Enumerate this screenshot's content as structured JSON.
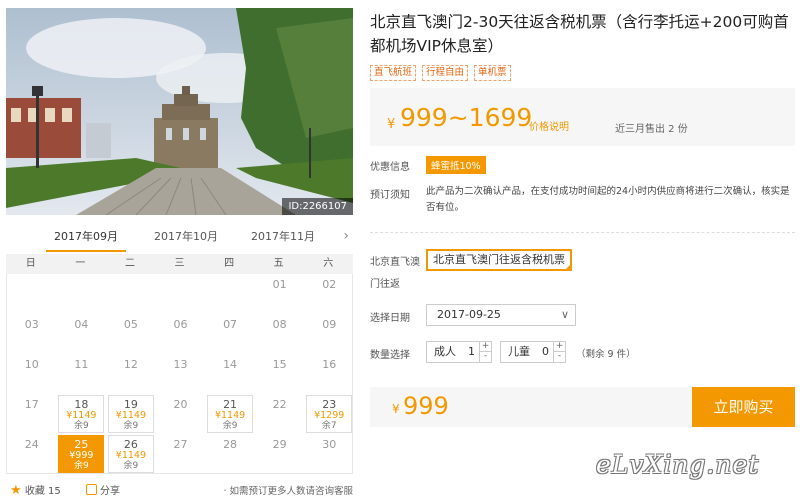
{
  "photo": {
    "id_label": "ID:2266107"
  },
  "calendar": {
    "months": [
      "2017年09月",
      "2017年10月",
      "2017年11月"
    ],
    "weekdays": [
      "日",
      "一",
      "二",
      "三",
      "四",
      "五",
      "六"
    ],
    "cells": [
      {
        "day": "01",
        "col": 5,
        "row": 0
      },
      {
        "day": "02",
        "col": 6,
        "row": 0
      },
      {
        "day": "03",
        "col": 0,
        "row": 1
      },
      {
        "day": "04",
        "col": 1,
        "row": 1
      },
      {
        "day": "05",
        "col": 2,
        "row": 1
      },
      {
        "day": "06",
        "col": 3,
        "row": 1
      },
      {
        "day": "07",
        "col": 4,
        "row": 1
      },
      {
        "day": "08",
        "col": 5,
        "row": 1
      },
      {
        "day": "09",
        "col": 6,
        "row": 1
      },
      {
        "day": "10",
        "col": 0,
        "row": 2
      },
      {
        "day": "11",
        "col": 1,
        "row": 2
      },
      {
        "day": "12",
        "col": 2,
        "row": 2
      },
      {
        "day": "13",
        "col": 3,
        "row": 2
      },
      {
        "day": "14",
        "col": 4,
        "row": 2
      },
      {
        "day": "15",
        "col": 5,
        "row": 2
      },
      {
        "day": "16",
        "col": 6,
        "row": 2
      },
      {
        "day": "17",
        "col": 0,
        "row": 3
      },
      {
        "day": "18",
        "col": 1,
        "row": 3,
        "price": "¥1149",
        "remain": "余9"
      },
      {
        "day": "19",
        "col": 2,
        "row": 3,
        "price": "¥1149",
        "remain": "余9"
      },
      {
        "day": "20",
        "col": 3,
        "row": 3
      },
      {
        "day": "21",
        "col": 4,
        "row": 3,
        "price": "¥1149",
        "remain": "余9"
      },
      {
        "day": "22",
        "col": 5,
        "row": 3
      },
      {
        "day": "23",
        "col": 6,
        "row": 3,
        "price": "¥1299",
        "remain": "余7"
      },
      {
        "day": "24",
        "col": 0,
        "row": 4
      },
      {
        "day": "25",
        "col": 1,
        "row": 4,
        "price": "¥999",
        "remain": "余9",
        "selected": true
      },
      {
        "day": "26",
        "col": 2,
        "row": 4,
        "price": "¥1149",
        "remain": "余9"
      },
      {
        "day": "27",
        "col": 3,
        "row": 4
      },
      {
        "day": "28",
        "col": 4,
        "row": 4
      },
      {
        "day": "29",
        "col": 5,
        "row": 4
      },
      {
        "day": "30",
        "col": 6,
        "row": 4
      }
    ]
  },
  "footer": {
    "favorite_label": "收藏 15",
    "share_label": "分享",
    "hint": "· 如需预订更多人数请咨询客服"
  },
  "product": {
    "title": "北京直飞澳门2-30天往返含税机票（含行李托运+200可购首都机场VIP休息室）",
    "tags": [
      "直飞航班",
      "行程自由",
      "单机票"
    ],
    "price_symbol": "¥",
    "price_range": "999~1699",
    "price_explain": "价格说明",
    "sold": "近三月售出 2 份",
    "discount_label": "优惠信息",
    "coupon": "蜂蜜抵10%",
    "notice_label": "预订须知",
    "notice_text": "此产品为二次确认产品，在支付成功时间起的24小时内供应商将进行二次确认，核实是否有位。",
    "route_label": "北京直飞澳门往返",
    "route_option": "北京直飞澳门往返含税机票",
    "date_label": "选择日期",
    "date_value": "2017-09-25",
    "qty_label": "数量选择",
    "adult_label": "成人",
    "adult_value": "1",
    "child_label": "儿童",
    "child_value": "0",
    "remain_text": "（剩余 9 件）",
    "total_symbol": "¥",
    "total_price": "999",
    "buy_label": "立即购买"
  },
  "watermark": "eLvXing.net",
  "colors": {
    "accent": "#f39800"
  }
}
